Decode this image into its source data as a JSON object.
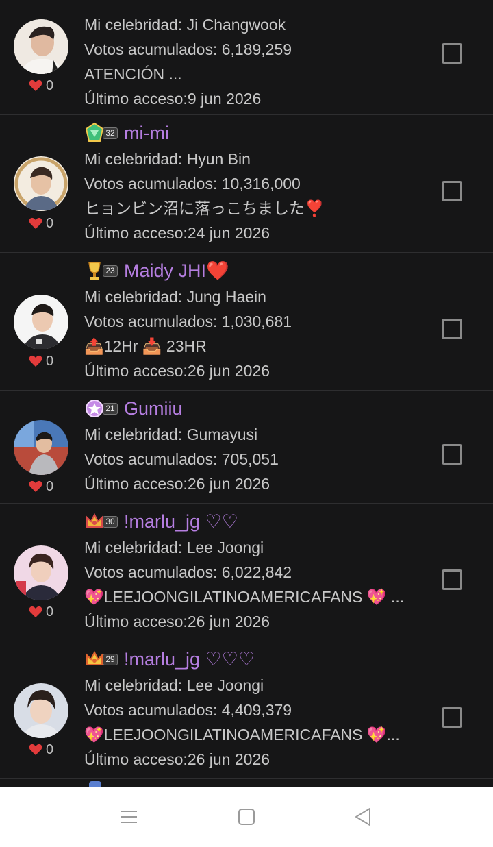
{
  "labels": {
    "celebrity_prefix": "Mi celebridad: ",
    "votes_prefix": "Votos acumulados: ",
    "access_prefix": "Último acceso:"
  },
  "rows": [
    {
      "username": "",
      "celebrity": "Ji Changwook",
      "votes": "6,189,259",
      "message": "ATENCIÓN ...",
      "last_access": "9 jun 2026",
      "likes": "0"
    },
    {
      "username": "mi-mi",
      "level": "32",
      "celebrity": "Hyun Bin",
      "votes": "10,316,000",
      "message": "ヒョンビン沼に落っこちました❣️",
      "last_access": "24 jun 2026",
      "likes": "0"
    },
    {
      "username": "Maidy JHI❤️",
      "level": "23",
      "celebrity": "Jung Haein",
      "votes": "1,030,681",
      "message": "📤12Hr 📥 23HR",
      "last_access": "26 jun 2026",
      "likes": "0"
    },
    {
      "username": "Gumiiu",
      "level": "21",
      "celebrity": "Gumayusi",
      "votes": "705,051",
      "last_access": "26 jun 2026",
      "likes": "0"
    },
    {
      "username": "!marlu_jg ♡♡",
      "level": "30",
      "celebrity": "Lee Joongi",
      "votes": "6,022,842",
      "message": "💖LEEJOONGILATINOAMERICAFANS 💖 ...",
      "last_access": "26 jun 2026",
      "likes": "0"
    },
    {
      "username": "!marlu_jg ♡♡♡",
      "level": "29",
      "celebrity": "Lee Joongi",
      "votes": "4,409,379",
      "message": "💖LEEJOONGILATINOAMERICAFANS 💖...",
      "last_access": "26 jun 2026",
      "likes": "0"
    }
  ],
  "navbar": {
    "menu_icon": "menu-icon",
    "home_icon": "home-square-icon",
    "back_icon": "back-triangle-icon"
  },
  "colors": {
    "background": "#161617",
    "username": "#b57ee0",
    "heart": "#e23b3b",
    "text": "#c8c8c8"
  }
}
